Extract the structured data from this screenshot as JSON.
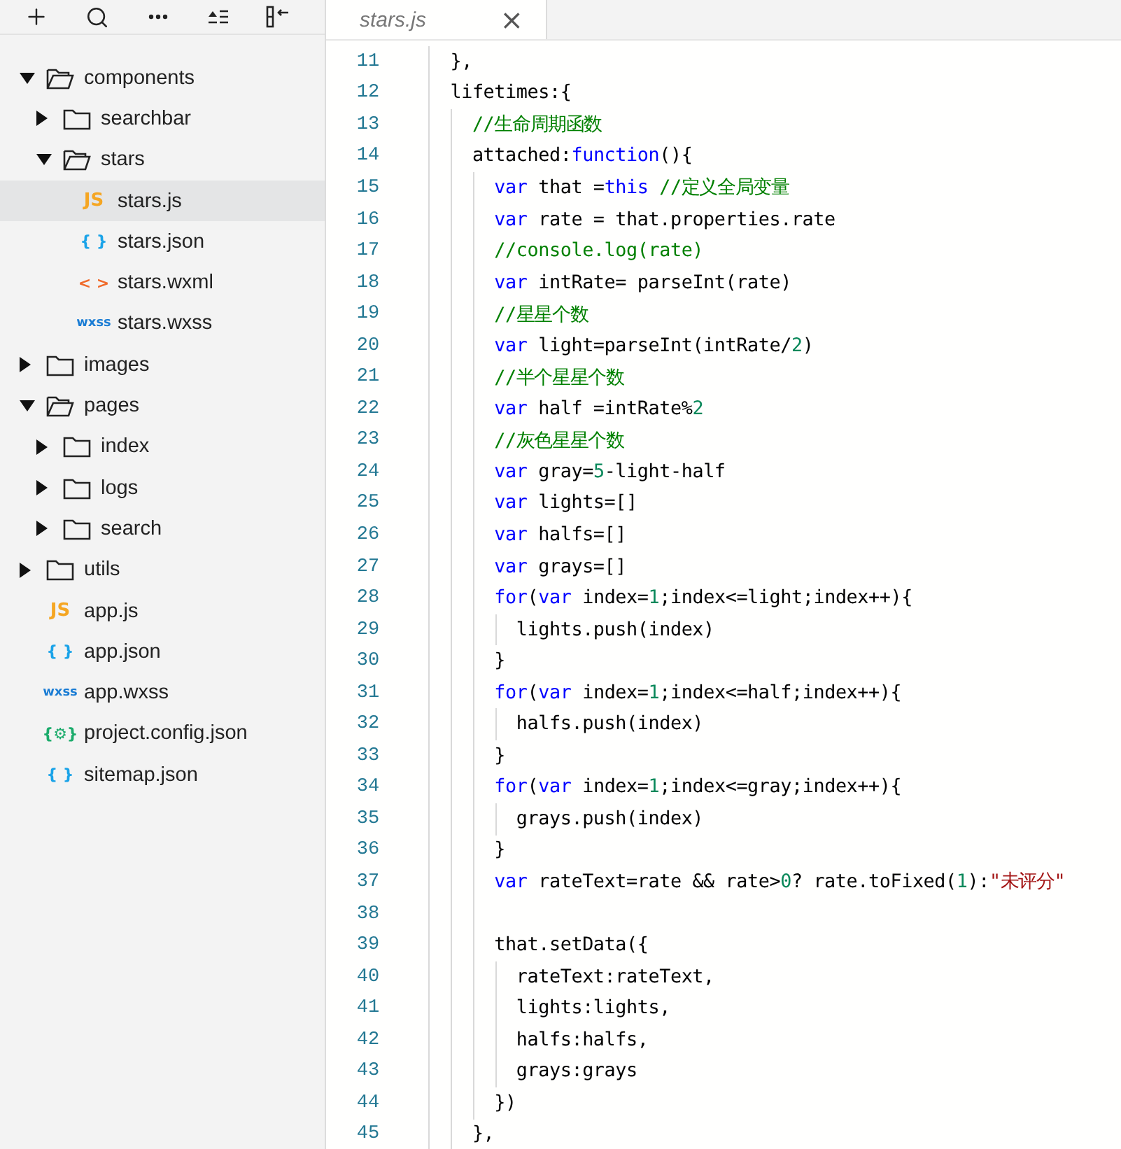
{
  "toolbar": {
    "buttons": [
      {
        "kind": "add"
      },
      {
        "kind": "search"
      },
      {
        "kind": "more"
      },
      {
        "kind": "collapse"
      },
      {
        "kind": "layout"
      }
    ]
  },
  "file_tree": [
    {
      "kind": "folder",
      "label": "components",
      "expanded": true,
      "children": [
        {
          "kind": "folder",
          "label": "searchbar",
          "expanded": false
        },
        {
          "kind": "folder",
          "label": "stars",
          "expanded": true,
          "children": [
            {
              "kind": "js",
              "icon": "JS",
              "label": "stars.js",
              "selected": true
            },
            {
              "kind": "json",
              "icon": "{ }",
              "label": "stars.json",
              "selected": false
            },
            {
              "kind": "wxml",
              "icon": "< >",
              "label": "stars.wxml",
              "selected": false
            },
            {
              "kind": "wxss",
              "icon": "wxss",
              "label": "stars.wxss",
              "selected": false
            }
          ]
        }
      ]
    },
    {
      "kind": "folder",
      "label": "images",
      "expanded": false
    },
    {
      "kind": "folder",
      "label": "pages",
      "expanded": true,
      "children": [
        {
          "kind": "folder",
          "label": "index",
          "expanded": false
        },
        {
          "kind": "folder",
          "label": "logs",
          "expanded": false
        },
        {
          "kind": "folder",
          "label": "search",
          "expanded": false
        }
      ]
    },
    {
      "kind": "folder",
      "label": "utils",
      "expanded": false
    },
    {
      "kind": "js",
      "icon": "JS",
      "label": "app.js",
      "selected": false
    },
    {
      "kind": "json",
      "icon": "{ }",
      "label": "app.json",
      "selected": false
    },
    {
      "kind": "wxss",
      "icon": "wxss",
      "label": "app.wxss",
      "selected": false
    },
    {
      "kind": "config",
      "icon": "{⚙}",
      "label": "project.config.json",
      "selected": false
    },
    {
      "kind": "json",
      "icon": "{ }",
      "label": "sitemap.json",
      "selected": false
    }
  ],
  "tabs": [
    {
      "label": "stars.js",
      "selected": true,
      "close": "×"
    }
  ],
  "code_lines": [
    {
      "number": "11",
      "tokens": [
        {
          "kind": "plain",
          "text": "  },"
        }
      ]
    },
    {
      "number": "12",
      "tokens": [
        {
          "kind": "plain",
          "text": "  lifetimes:{"
        }
      ]
    },
    {
      "number": "13",
      "tokens": [
        {
          "kind": "comment",
          "text": "    //生命周期函数"
        }
      ]
    },
    {
      "number": "14",
      "tokens": [
        {
          "kind": "plain",
          "text": "    attached:"
        },
        {
          "kind": "keyword",
          "text": "function"
        },
        {
          "kind": "plain",
          "text": "(){"
        }
      ]
    },
    {
      "number": "15",
      "tokens": [
        {
          "kind": "keyword",
          "text": "      var"
        },
        {
          "kind": "plain",
          "text": " that ="
        },
        {
          "kind": "keyword",
          "text": "this"
        },
        {
          "kind": "comment",
          "text": " //定义全局变量"
        }
      ]
    },
    {
      "number": "16",
      "tokens": [
        {
          "kind": "keyword",
          "text": "      var"
        },
        {
          "kind": "plain",
          "text": " rate = that.properties.rate"
        }
      ]
    },
    {
      "number": "17",
      "tokens": [
        {
          "kind": "comment",
          "text": "      //console.log(rate)"
        }
      ]
    },
    {
      "number": "18",
      "tokens": [
        {
          "kind": "keyword",
          "text": "      var"
        },
        {
          "kind": "plain",
          "text": " intRate= parseInt(rate)"
        }
      ]
    },
    {
      "number": "19",
      "tokens": [
        {
          "kind": "comment",
          "text": "      //星星个数"
        }
      ]
    },
    {
      "number": "20",
      "tokens": [
        {
          "kind": "keyword",
          "text": "      var"
        },
        {
          "kind": "plain",
          "text": " light=parseInt(intRate/"
        },
        {
          "kind": "number",
          "text": "2"
        },
        {
          "kind": "plain",
          "text": ")"
        }
      ]
    },
    {
      "number": "21",
      "tokens": [
        {
          "kind": "comment",
          "text": "      //半个星星个数"
        }
      ]
    },
    {
      "number": "22",
      "tokens": [
        {
          "kind": "keyword",
          "text": "      var"
        },
        {
          "kind": "plain",
          "text": " half =intRate%"
        },
        {
          "kind": "number",
          "text": "2"
        }
      ]
    },
    {
      "number": "23",
      "tokens": [
        {
          "kind": "comment",
          "text": "      //灰色星星个数"
        }
      ]
    },
    {
      "number": "24",
      "tokens": [
        {
          "kind": "keyword",
          "text": "      var"
        },
        {
          "kind": "plain",
          "text": " gray="
        },
        {
          "kind": "number",
          "text": "5"
        },
        {
          "kind": "plain",
          "text": "-light-half"
        }
      ]
    },
    {
      "number": "25",
      "tokens": [
        {
          "kind": "keyword",
          "text": "      var"
        },
        {
          "kind": "plain",
          "text": " lights=[]"
        }
      ]
    },
    {
      "number": "26",
      "tokens": [
        {
          "kind": "keyword",
          "text": "      var"
        },
        {
          "kind": "plain",
          "text": " halfs=[]"
        }
      ]
    },
    {
      "number": "27",
      "tokens": [
        {
          "kind": "keyword",
          "text": "      var"
        },
        {
          "kind": "plain",
          "text": " grays=[]"
        }
      ]
    },
    {
      "number": "28",
      "tokens": [
        {
          "kind": "keyword",
          "text": "      for"
        },
        {
          "kind": "plain",
          "text": "("
        },
        {
          "kind": "keyword",
          "text": "var"
        },
        {
          "kind": "plain",
          "text": " index="
        },
        {
          "kind": "number",
          "text": "1"
        },
        {
          "kind": "plain",
          "text": ";index<=light;index++){"
        }
      ]
    },
    {
      "number": "29",
      "tokens": [
        {
          "kind": "plain",
          "text": "        lights.push(index)"
        }
      ]
    },
    {
      "number": "30",
      "tokens": [
        {
          "kind": "plain",
          "text": "      }"
        }
      ]
    },
    {
      "number": "31",
      "tokens": [
        {
          "kind": "keyword",
          "text": "      for"
        },
        {
          "kind": "plain",
          "text": "("
        },
        {
          "kind": "keyword",
          "text": "var"
        },
        {
          "kind": "plain",
          "text": " index="
        },
        {
          "kind": "number",
          "text": "1"
        },
        {
          "kind": "plain",
          "text": ";index<=half;index++){"
        }
      ]
    },
    {
      "number": "32",
      "tokens": [
        {
          "kind": "plain",
          "text": "        halfs.push(index)"
        }
      ]
    },
    {
      "number": "33",
      "tokens": [
        {
          "kind": "plain",
          "text": "      }"
        }
      ]
    },
    {
      "number": "34",
      "tokens": [
        {
          "kind": "keyword",
          "text": "      for"
        },
        {
          "kind": "plain",
          "text": "("
        },
        {
          "kind": "keyword",
          "text": "var"
        },
        {
          "kind": "plain",
          "text": " index="
        },
        {
          "kind": "number",
          "text": "1"
        },
        {
          "kind": "plain",
          "text": ";index<=gray;index++){"
        }
      ]
    },
    {
      "number": "35",
      "tokens": [
        {
          "kind": "plain",
          "text": "        grays.push(index)"
        }
      ]
    },
    {
      "number": "36",
      "tokens": [
        {
          "kind": "plain",
          "text": "      }"
        }
      ]
    },
    {
      "number": "37",
      "tokens": [
        {
          "kind": "keyword",
          "text": "      var"
        },
        {
          "kind": "plain",
          "text": " rateText=rate && rate>"
        },
        {
          "kind": "number",
          "text": "0"
        },
        {
          "kind": "plain",
          "text": "? rate.toFixed("
        },
        {
          "kind": "number",
          "text": "1"
        },
        {
          "kind": "plain",
          "text": "):"
        },
        {
          "kind": "string",
          "text": "\"未评分\""
        }
      ]
    },
    {
      "number": "38"
    },
    {
      "number": "39",
      "tokens": [
        {
          "kind": "plain",
          "text": "      that.setData({"
        }
      ]
    },
    {
      "number": "40",
      "tokens": [
        {
          "kind": "plain",
          "text": "        rateText:rateText,"
        }
      ]
    },
    {
      "number": "41",
      "tokens": [
        {
          "kind": "plain",
          "text": "        lights:lights,"
        }
      ]
    },
    {
      "number": "42",
      "tokens": [
        {
          "kind": "plain",
          "text": "        halfs:halfs,"
        }
      ]
    },
    {
      "number": "43",
      "tokens": [
        {
          "kind": "plain",
          "text": "        grays:grays"
        }
      ]
    },
    {
      "number": "44",
      "tokens": [
        {
          "kind": "plain",
          "text": "      })"
        }
      ]
    },
    {
      "number": "45",
      "tokens": [
        {
          "kind": "plain",
          "text": "    },"
        }
      ]
    }
  ]
}
